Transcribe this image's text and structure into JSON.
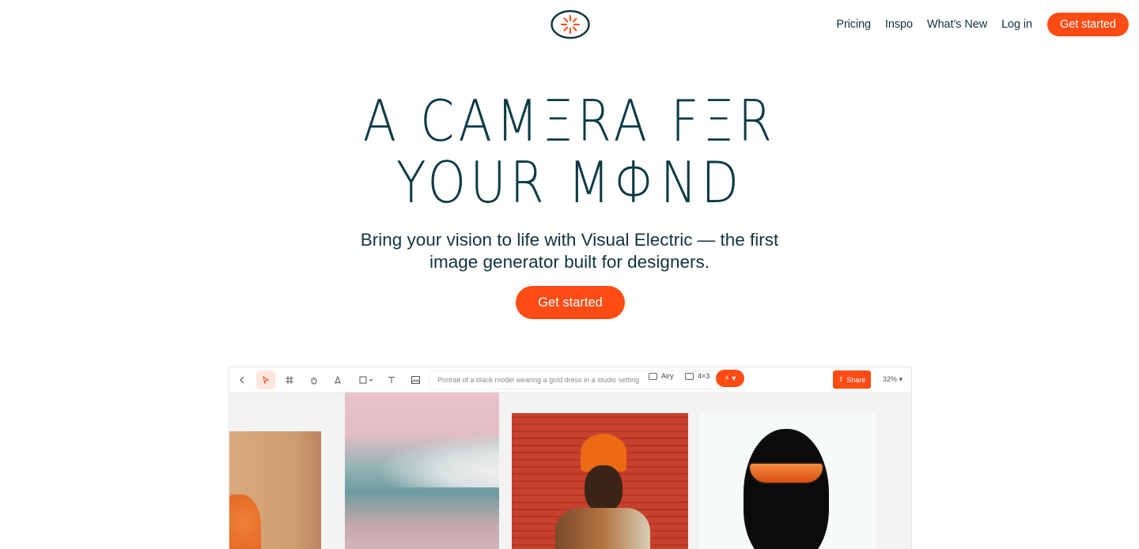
{
  "nav": {
    "logo_icon": "sun-burst-icon",
    "links": [
      "Pricing",
      "Inspo",
      "What’s New",
      "Log in"
    ],
    "cta": "Get started"
  },
  "hero": {
    "title_line1": "A CAMΞRA FΞR",
    "title_line2": "YOUR MΦND",
    "subtitle_line1": "Bring your vision to life with Visual Electric — the first",
    "subtitle_line2": "image generator built for designers.",
    "cta": "Get started"
  },
  "app": {
    "toolbar": {
      "prompt": "Portrait of a black model wearing a gold dress in a studio setting",
      "style_chip": "Airy",
      "aspect_chip": "4×3",
      "share": "Share",
      "zoom": "32%"
    }
  },
  "colors": {
    "accent": "#ff4b14",
    "text": "#10343f"
  }
}
